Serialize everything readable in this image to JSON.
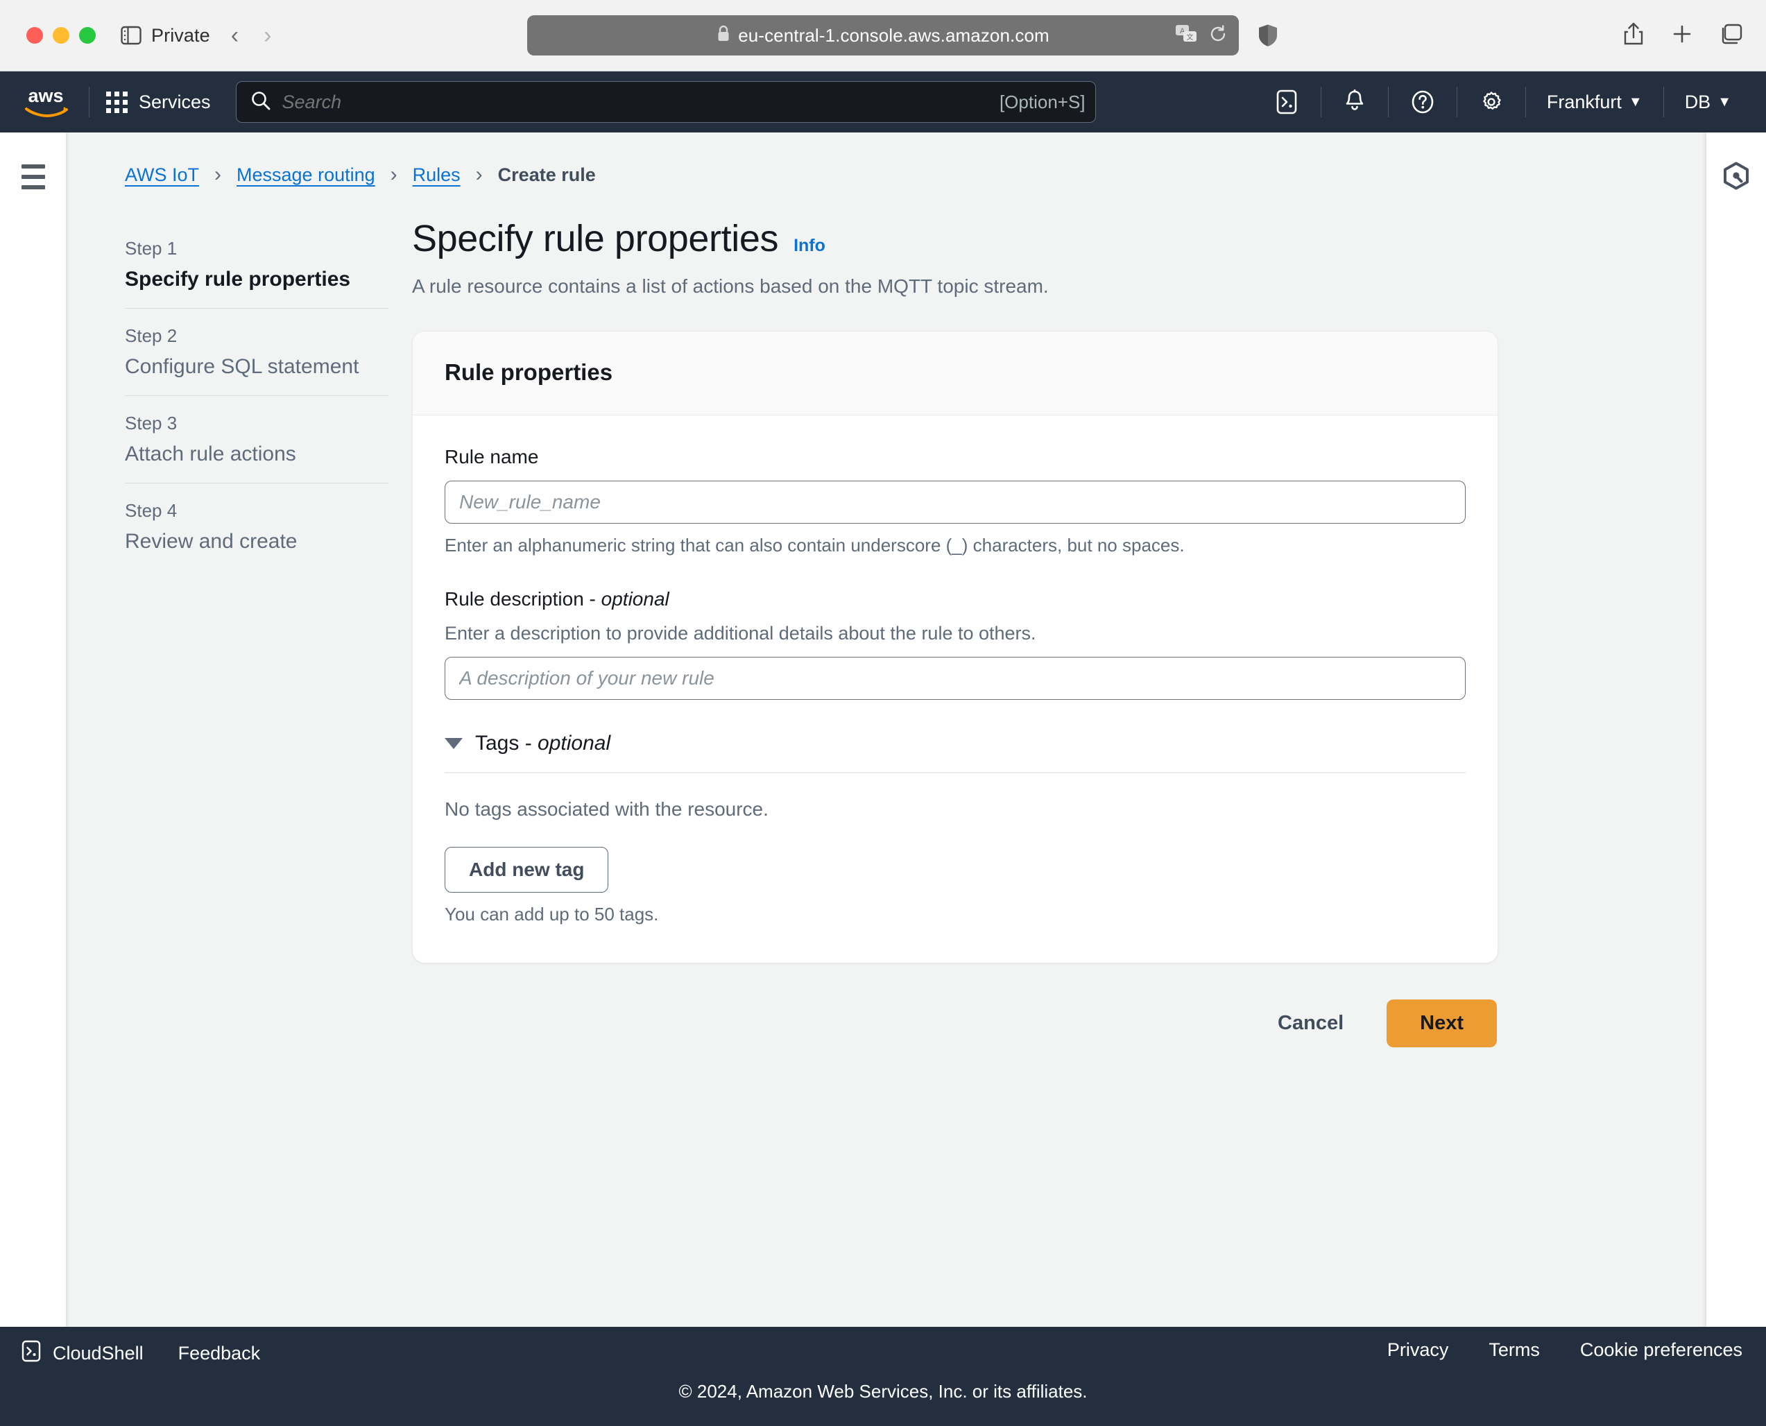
{
  "browser": {
    "private_label": "Private",
    "url": "eu-central-1.console.aws.amazon.com",
    "lock_icon": "lock-icon",
    "translate_icon": "translate-icon",
    "reload_icon": "reload-icon",
    "shield_icon": "shield-icon",
    "share_icon": "share-icon",
    "new_tab_icon": "plus-icon",
    "tabs_icon": "tabs-overview-icon",
    "sidebar_icon": "sidebar-toggle-icon",
    "back_icon": "chevron-left-icon",
    "forward_icon": "chevron-right-icon"
  },
  "topnav": {
    "logo": "aws-logo",
    "services_label": "Services",
    "search_placeholder": "Search",
    "search_shortcut": "[Option+S]",
    "cloudshell_icon": "cloudshell-icon",
    "notifications_icon": "bell-icon",
    "help_icon": "question-circle-icon",
    "settings_icon": "gear-icon",
    "region_label": "Frankfurt",
    "account_label": "DB",
    "caret": "▼"
  },
  "left_rail": {
    "menu_icon": "hamburger-menu-icon"
  },
  "right_rail": {
    "q_icon": "amazon-q-icon"
  },
  "breadcrumb": {
    "items": [
      {
        "label": "AWS IoT",
        "link": true
      },
      {
        "label": "Message routing",
        "link": true
      },
      {
        "label": "Rules",
        "link": true
      },
      {
        "label": "Create rule",
        "link": false
      }
    ],
    "separator": "›"
  },
  "steps": [
    {
      "num": "Step 1",
      "title": "Specify rule properties",
      "active": true
    },
    {
      "num": "Step 2",
      "title": "Configure SQL statement",
      "active": false
    },
    {
      "num": "Step 3",
      "title": "Attach rule actions",
      "active": false
    },
    {
      "num": "Step 4",
      "title": "Review and create",
      "active": false
    }
  ],
  "page": {
    "title": "Specify rule properties",
    "info_label": "Info",
    "subtitle": "A rule resource contains a list of actions based on the MQTT topic stream."
  },
  "card": {
    "header_title": "Rule properties",
    "rule_name": {
      "label": "Rule name",
      "value": "",
      "placeholder": "New_rule_name",
      "hint": "Enter an alphanumeric string that can also contain underscore (_) characters, but no spaces."
    },
    "rule_description": {
      "label_main": "Rule description - ",
      "label_optional": "optional",
      "description": "Enter a description to provide additional details about the rule to others.",
      "value": "",
      "placeholder": "A description of your new rule"
    },
    "tags": {
      "title_main": "Tags - ",
      "title_optional": "optional",
      "expanded": true,
      "empty_text": "No tags associated with the resource.",
      "add_button": "Add new tag",
      "hint": "You can add up to 50 tags."
    }
  },
  "actions": {
    "cancel_label": "Cancel",
    "next_label": "Next",
    "primary_color": "#ec9c32"
  },
  "footer": {
    "cloudshell_label": "CloudShell",
    "cloudshell_icon": "cloudshell-icon",
    "feedback_label": "Feedback",
    "privacy_label": "Privacy",
    "terms_label": "Terms",
    "cookie_label": "Cookie preferences",
    "copyright": "© 2024, Amazon Web Services, Inc. or its affiliates."
  }
}
